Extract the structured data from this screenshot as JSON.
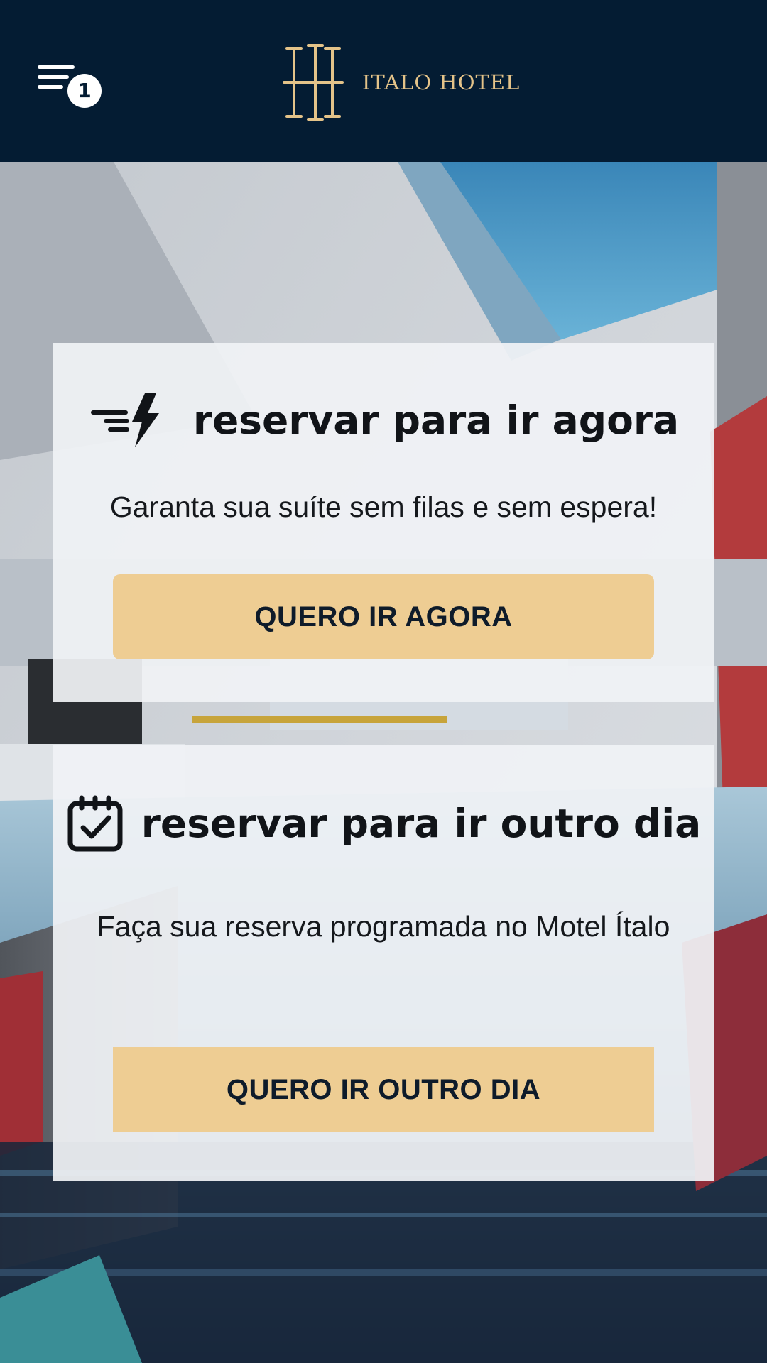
{
  "colors": {
    "header_bg": "#041c33",
    "brand_gold": "#e4c389",
    "button_bg": "#eecd93",
    "card_bg": "#f0f2f5",
    "text_dark": "#111418"
  },
  "header": {
    "menu_icon": "menu-lines-icon",
    "menu_badge_count": "1",
    "logo_icon": "italo-hotel-monogram-logo",
    "logo_text": "ITALO HOTEL"
  },
  "hero": {
    "background": "indoor-pool-photo"
  },
  "cards": [
    {
      "icon": "fast-lightning-icon",
      "title": "reservar para ir agora",
      "description": "Garanta sua suíte sem filas e sem espera!",
      "button_label": "QUERO IR AGORA"
    },
    {
      "icon": "calendar-check-icon",
      "title": "reservar para ir outro dia",
      "description": "Faça sua reserva programada no Motel Ítalo",
      "button_label": "QUERO IR OUTRO DIA"
    }
  ]
}
